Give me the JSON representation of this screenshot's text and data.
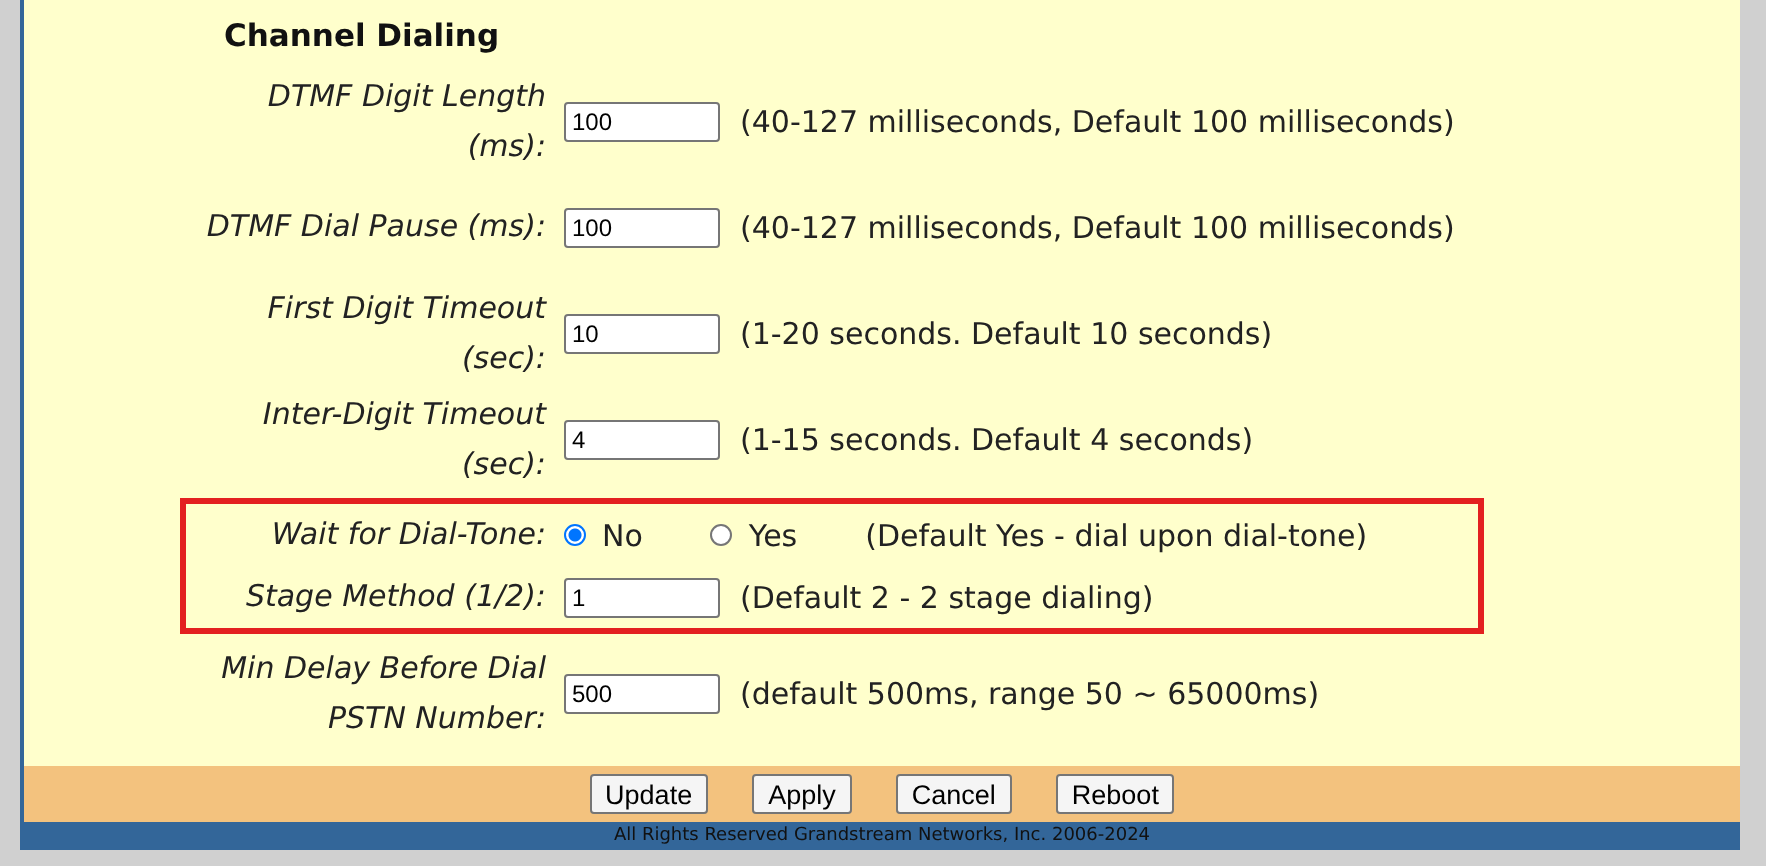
{
  "section": {
    "title": "Channel Dialing"
  },
  "groups": [
    {
      "highlighted": false,
      "rows": [
        {
          "kind": "text",
          "label": "DTMF Digit Length (ms):",
          "value": "100",
          "hint": "(40-127 milliseconds, Default 100 milliseconds)"
        },
        {
          "kind": "text",
          "label": "DTMF Dial Pause (ms):",
          "value": "100",
          "hint": "(40-127 milliseconds, Default 100 milliseconds)"
        },
        {
          "kind": "text",
          "label": "First Digit Timeout (sec):",
          "value": "10",
          "hint": "(1-20 seconds. Default 10 seconds)"
        },
        {
          "kind": "text",
          "label": "Inter-Digit Timeout (sec):",
          "value": "4",
          "hint": "(1-15 seconds. Default 4 seconds)"
        }
      ]
    },
    {
      "highlighted": true,
      "rows": [
        {
          "kind": "radio",
          "label": "Wait for Dial-Tone:",
          "options": [
            {
              "label": "No",
              "selected": true
            },
            {
              "label": "Yes",
              "selected": false
            }
          ],
          "hint": "(Default Yes - dial upon dial-tone)"
        },
        {
          "kind": "text",
          "label": "Stage Method (1/2):",
          "value": "1",
          "hint": "(Default 2 - 2 stage dialing)"
        }
      ]
    },
    {
      "highlighted": false,
      "rows": [
        {
          "kind": "text",
          "label": "Min Delay Before Dial PSTN Number:",
          "value": "500",
          "hint": "(default 500ms, range 50 ~ 65000ms)"
        }
      ]
    }
  ],
  "buttons": [
    "Update",
    "Apply",
    "Cancel",
    "Reboot"
  ],
  "footer": "All Rights Reserved Grandstream Networks, Inc. 2006-2024"
}
